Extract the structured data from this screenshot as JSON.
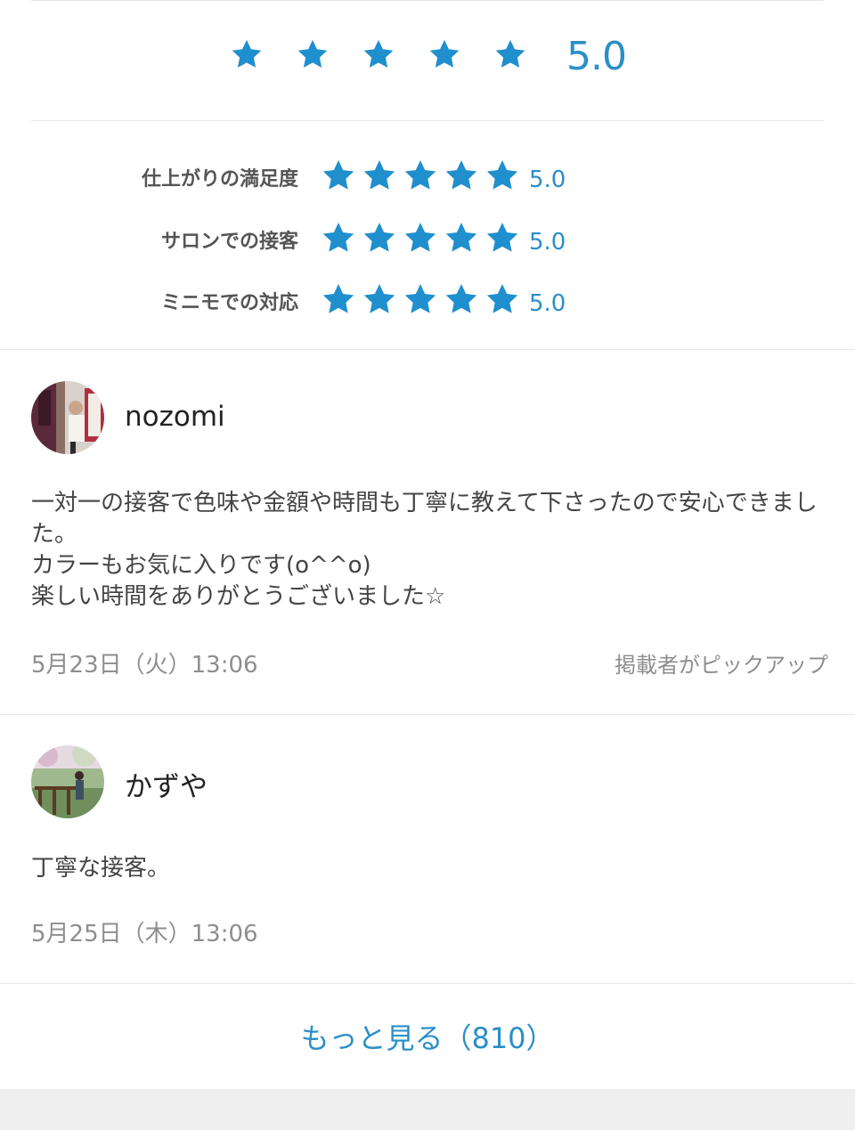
{
  "colors": {
    "accent": "#2a8fc7",
    "star": "#1f8fce"
  },
  "overall": {
    "rating": 5,
    "score": "5.0"
  },
  "categories": [
    {
      "label": "仕上がりの満足度",
      "rating": 5,
      "score": "5.0"
    },
    {
      "label": "サロンでの接客",
      "rating": 5,
      "score": "5.0"
    },
    {
      "label": "ミニモでの対応",
      "rating": 5,
      "score": "5.0"
    }
  ],
  "reviews": [
    {
      "username": "nozomi",
      "text": "一対一の接客で色味や金額や時間も丁寧に教えて下さったので安心できました。\nカラーもお気に入りです(o^^o)\n楽しい時間をありがとうございました☆",
      "date": "5月23日（火）13:06",
      "pickup": "掲載者がピックアップ"
    },
    {
      "username": "かずや",
      "text": "丁寧な接客。",
      "date": "5月25日（木）13:06"
    }
  ],
  "more_link": "もっと見る（810）"
}
